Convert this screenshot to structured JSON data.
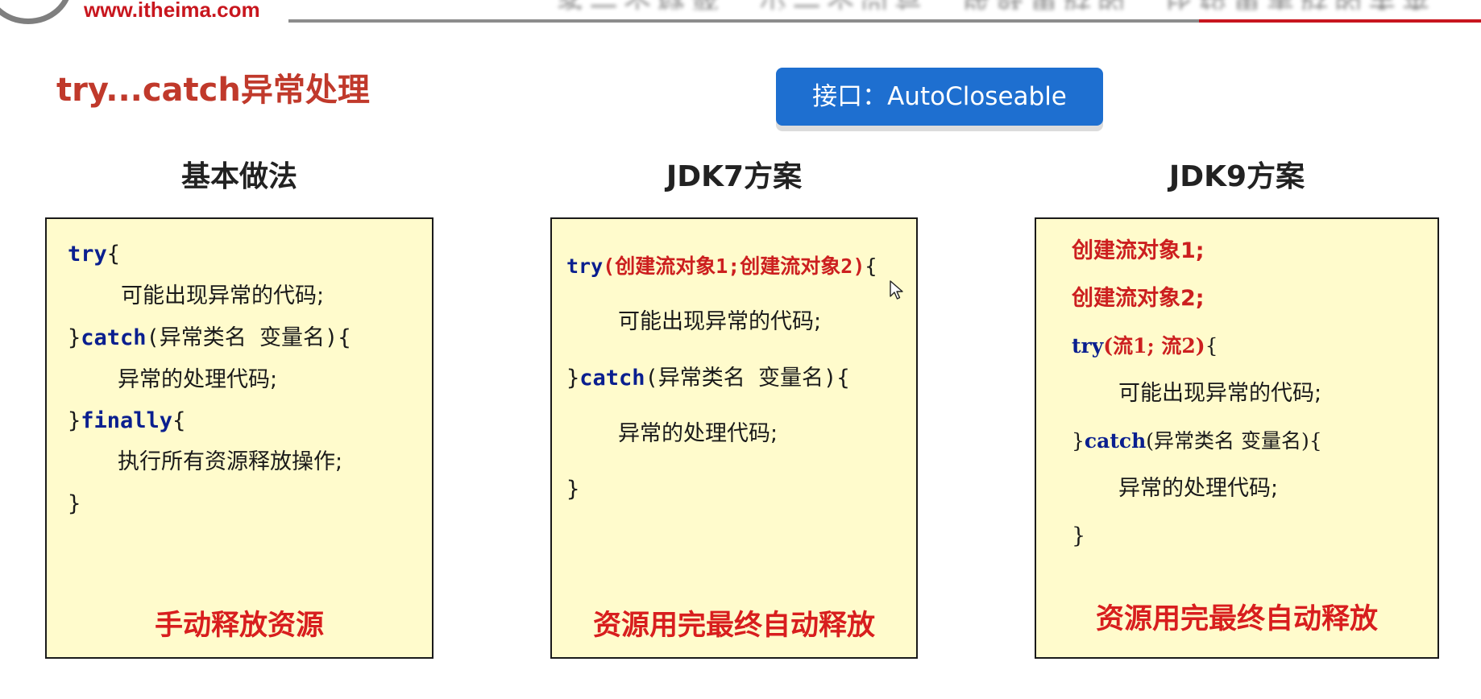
{
  "header": {
    "logo_url": "www.itheima.com",
    "blurred_text": "多一个疑惑，少一个问号，成就更好的，比较更美好的未来"
  },
  "section_title": "try...catch异常处理",
  "interface_badge": "接口：AutoCloseable",
  "columns": [
    {
      "title": "基本做法",
      "lines": {
        "l1_kw": "try",
        "l1_rest": "{",
        "l2": "可能出现异常的代码;",
        "l3_pre": "}",
        "l3_kw": "catch",
        "l3_rest": "(异常类名 变量名){",
        "l4": "异常的处理代码;",
        "l5_pre": "}",
        "l5_kw": "finally",
        "l5_rest": "{",
        "l6": "执行所有资源释放操作;",
        "l7": "}"
      },
      "footer": "手动释放资源"
    },
    {
      "title": "JDK7方案",
      "lines": {
        "l1_kw": "try",
        "l1_red": "(创建流对象1;创建流对象2)",
        "l1_rest": "{",
        "l2": "可能出现异常的代码;",
        "l3_pre": "}",
        "l3_kw": "catch",
        "l3_rest": "(异常类名 变量名){",
        "l4": "异常的处理代码;",
        "l5": "}"
      },
      "footer": "资源用完最终自动释放"
    },
    {
      "title": "JDK9方案",
      "lines": {
        "l1": "创建流对象1;",
        "l2": "创建流对象2;",
        "l3_kw": "try",
        "l3_red": "(流1; 流2)",
        "l3_rest": "{",
        "l4": "可能出现异常的代码;",
        "l5_pre": "}",
        "l5_kw": "catch",
        "l5_rest": "(异常类名 变量名){",
        "l6": "异常的处理代码;",
        "l7": "}"
      },
      "footer": "资源用完最终自动释放"
    }
  ],
  "colors": {
    "title_red": "#c0392b",
    "badge_blue": "#1e6fd0",
    "box_fill": "#fffbcc",
    "keyword_blue": "#0a1f8f",
    "footer_red": "#d81e1e"
  }
}
